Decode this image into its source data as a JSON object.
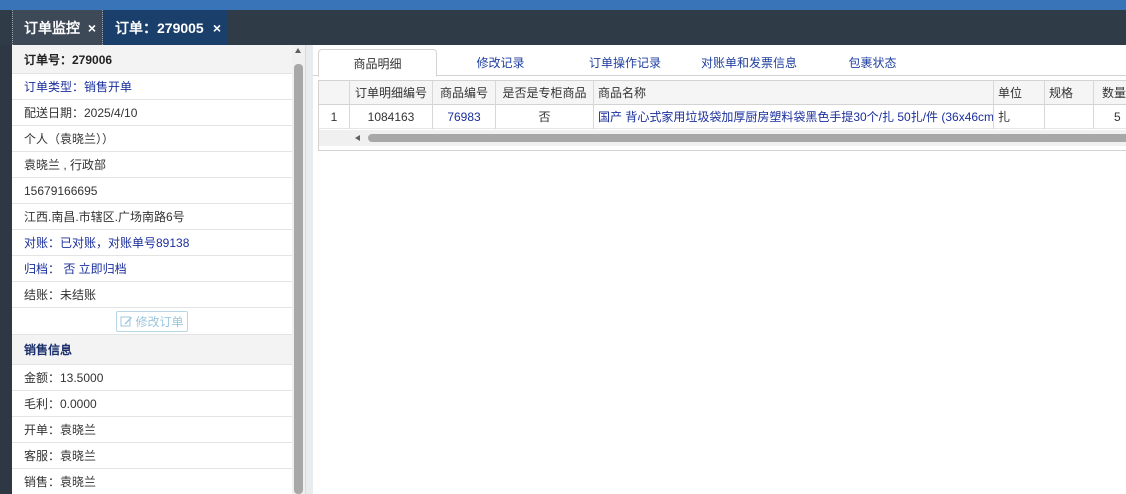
{
  "tabs": [
    {
      "label": "订单监控",
      "close": "×"
    },
    {
      "label": "订单：279005",
      "close": "×"
    }
  ],
  "order": {
    "number": "订单号：279006",
    "type": "订单类型：销售开单",
    "delivery_date": "配送日期：2025/4/10",
    "customer": "个人（袁晓兰））",
    "contact": "袁晓兰 , 行政部",
    "phone": "15679166695",
    "address": "江西.南昌.市辖区.广场南路6号",
    "reconcile": "对账：已对账，对账单号89138",
    "archive": "归档： 否 立即归档",
    "settle": "结账：未结账",
    "edit_button": "修改订单"
  },
  "sales": {
    "section_title": "销售信息",
    "amount": "金额：13.5000",
    "gross_profit": "毛利：0.0000",
    "opener": "开单：袁晓兰",
    "service": "客服：袁晓兰",
    "sales": "销售：袁晓兰"
  },
  "detail_tabs": [
    "商品明细",
    "修改记录",
    "订单操作记录",
    "对账单和发票信息",
    "包裹状态"
  ],
  "grid": {
    "columns": [
      "订单明细编号",
      "商品编号",
      "是否是专柜商品",
      "商品名称",
      "单位",
      "规格",
      "数量"
    ],
    "rows": [
      {
        "index": "1",
        "detail_id": "1084163",
        "product_id": "76983",
        "counter": "否",
        "name": "国产 背心式家用垃圾袋加厚厨房塑料袋黑色手提30个/扎 50扎/件 (36x46cm",
        "unit": "扎",
        "spec": "",
        "qty": "5"
      }
    ]
  },
  "icons": {
    "edit": "edit-icon"
  },
  "colors": {
    "tabbar": "#2f3b47",
    "active_tab": "#1b3f6b",
    "link": "#1a2f9c",
    "accent_top": "#3a74b8"
  }
}
